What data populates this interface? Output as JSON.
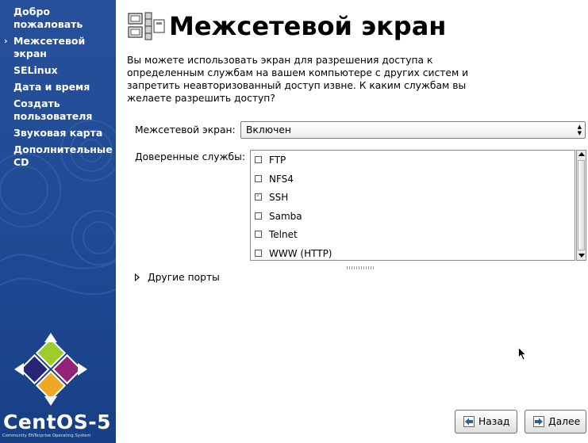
{
  "sidebar": {
    "steps": [
      {
        "label": "Добро пожаловать",
        "current": false
      },
      {
        "label": "Межсетевой экран",
        "current": true
      },
      {
        "label": "SELinux",
        "current": false
      },
      {
        "label": "Дата и время",
        "current": false
      },
      {
        "label": "Создать пользователя",
        "current": false
      },
      {
        "label": "Звуковая карта",
        "current": false
      },
      {
        "label": "Дополнительные CD",
        "current": false
      }
    ],
    "current_marker": "›",
    "brand": {
      "name": "CentOS-5",
      "tagline": "Community ENTerprise Operating System"
    }
  },
  "page": {
    "title": "Межсетевой экран",
    "description": "Вы можете использовать экран для разрешения доступа к определенным службам на вашем компьютере с других систем и запретить неавторизованный доступ извне.  К каким службам вы желаете разрешить доступ?"
  },
  "firewall": {
    "label": "Межсетевой экран:",
    "value": "Включен"
  },
  "services": {
    "label": "Доверенные службы:",
    "items": [
      {
        "name": "FTP",
        "checked": false
      },
      {
        "name": "NFS4",
        "checked": false
      },
      {
        "name": "SSH",
        "checked": true
      },
      {
        "name": "Samba",
        "checked": false
      },
      {
        "name": "Telnet",
        "checked": false
      },
      {
        "name": "WWW (HTTP)",
        "checked": false
      }
    ]
  },
  "other_ports": {
    "label": "Другие порты"
  },
  "buttons": {
    "back": "Назад",
    "next": "Далее"
  },
  "colors": {
    "sidebar": "#1f4a93",
    "checkmark": "#6f8fbf"
  }
}
